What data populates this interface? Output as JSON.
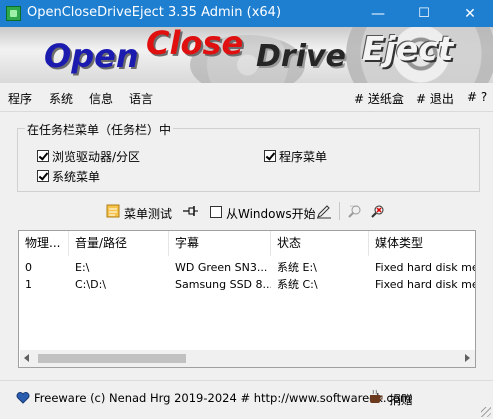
{
  "window": {
    "title": "OpenCloseDriveEject 3.35 Admin (x64)",
    "minimize_glyph": "—",
    "maximize_glyph": "☐",
    "close_glyph": "✕"
  },
  "banner": {
    "open": "Open",
    "close": "Close",
    "drive": "Drive",
    "eject": "Eject"
  },
  "menu": {
    "left": [
      "程序",
      "系统",
      "信息",
      "语言"
    ],
    "right": [
      "# 送纸盒",
      "# 退出",
      "# ?"
    ]
  },
  "group": {
    "title": "在任务栏菜单（任务栏）中",
    "checkboxes": [
      {
        "label": "浏览驱动器/分区",
        "checked": true
      },
      {
        "label": "程序菜单",
        "checked": true
      },
      {
        "label": "系统菜单",
        "checked": true
      }
    ]
  },
  "toolbar": {
    "menu_test": "菜单测试",
    "startup_label": "从Windows开始",
    "startup_checked": false
  },
  "table": {
    "headers": [
      "物理...",
      "音量/路径",
      "字幕",
      "状态",
      "媒体类型"
    ],
    "rows": [
      [
        "0",
        "E:\\",
        "WD Green SN3...",
        "系统 E:\\",
        "Fixed hard disk medi"
      ],
      [
        "1",
        "C:\\D:\\",
        "Samsung SSD 8...",
        "系统 C:\\",
        "Fixed hard disk medi"
      ]
    ]
  },
  "footer": {
    "text": "Freeware (c) Nenad Hrg 2019-2024 # http://www.softwareok.com",
    "donate": "捐赠"
  },
  "colors": {
    "titlebar": "#1e7fd1",
    "open_text": "#1b1bb0",
    "close_text": "#e01010"
  },
  "icons": [
    "app-icon",
    "menu-test-icon",
    "pin-icon",
    "edit-icon",
    "zoom-icon",
    "eject-icon",
    "heart-icon",
    "coffee-icon"
  ]
}
